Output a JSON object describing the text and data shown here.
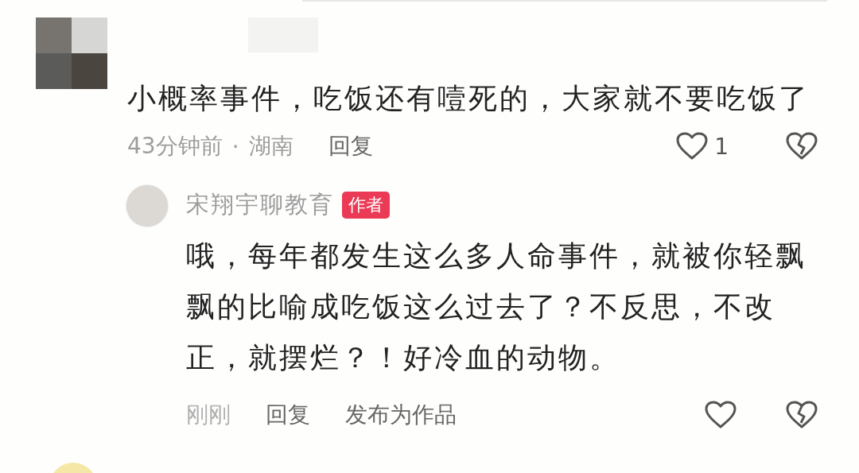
{
  "comments": [
    {
      "text": "小概率事件，吃饭还有噎死的，大家就不要吃饭了",
      "time": "43分钟前",
      "separator": "·",
      "location": "湖南",
      "actions": [
        "回复"
      ],
      "like_count": "1",
      "replies": [
        {
          "name": "宋翔宇聊教育",
          "badge": "作者",
          "text": "哦，每年都发生这么多人命事件，就被你轻飘飘的比喻成吃饭这么过去了？不反思，不改正，就摆烂？！好冷血的动物。",
          "time": "刚刚",
          "actions": [
            "回复",
            "发布为作品"
          ]
        }
      ]
    }
  ]
}
